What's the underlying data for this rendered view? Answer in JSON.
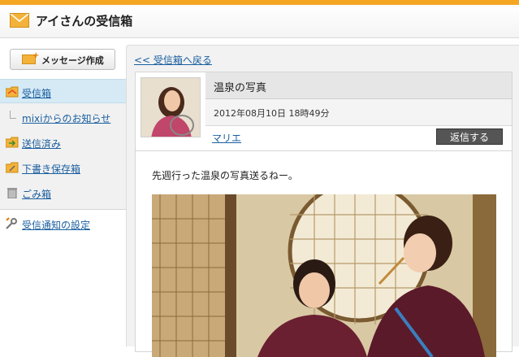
{
  "header": {
    "title": "アイさんの受信箱",
    "icon": "mail-envelope-icon",
    "accent_color": "#f5a623"
  },
  "sidebar": {
    "compose_label": "メッセージ作成",
    "items": [
      {
        "label": "受信箱",
        "icon": "inbox-folder-icon",
        "active": true
      },
      {
        "label": "mixiからのお知らせ",
        "icon": "branch-icon"
      },
      {
        "label": "送信済み",
        "icon": "sent-folder-icon"
      },
      {
        "label": "下書き保存箱",
        "icon": "draft-folder-icon"
      },
      {
        "label": "ごみ箱",
        "icon": "trash-icon"
      }
    ],
    "settings_label": "受信通知の設定"
  },
  "main": {
    "back_label": "<< 受信箱へ戻る",
    "message": {
      "subject": "温泉の写真",
      "date": "2012年08月10日 18時49分",
      "sender": "マリエ",
      "reply_label": "返信する",
      "body": "先週行った温泉の写真送るねー。"
    }
  }
}
